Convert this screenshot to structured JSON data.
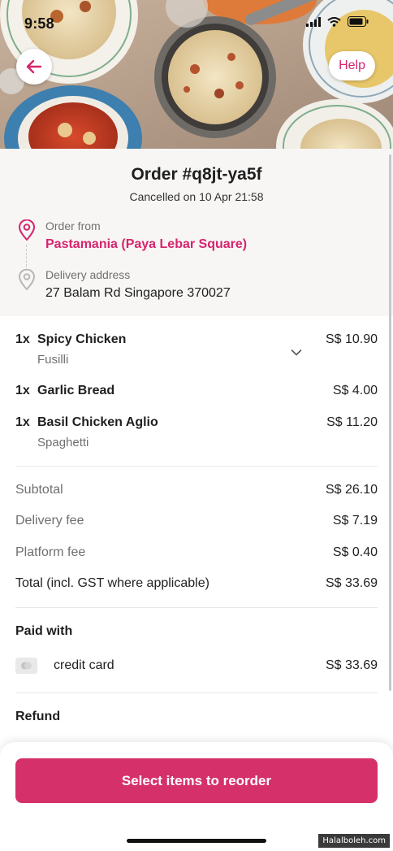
{
  "status_bar": {
    "time": "9:58"
  },
  "header": {
    "help_label": "Help",
    "back_icon": "arrow-left-icon"
  },
  "order": {
    "title": "Order #q8jt-ya5f",
    "status": "Cancelled on 10 Apr 21:58",
    "from_label": "Order from",
    "restaurant": "Pastamania (Paya Lebar Square)",
    "address_label": "Delivery address",
    "address": "27 Balam Rd Singapore 370027"
  },
  "items": [
    {
      "qty": "1x",
      "name": "Spicy Chicken",
      "option": "Fusilli",
      "price": "S$ 10.90"
    },
    {
      "qty": "1x",
      "name": "Garlic Bread",
      "option": "",
      "price": "S$ 4.00"
    },
    {
      "qty": "1x",
      "name": "Basil Chicken Aglio",
      "option": "Spaghetti",
      "price": "S$ 11.20"
    }
  ],
  "summary": {
    "subtotal_label": "Subtotal",
    "subtotal": "S$ 26.10",
    "delivery_label": "Delivery fee",
    "delivery": "S$ 7.19",
    "platform_label": "Platform fee",
    "platform": "S$ 0.40",
    "total_label": "Total (incl. GST where applicable)",
    "total": "S$ 33.69"
  },
  "payment": {
    "title": "Paid with",
    "method": "credit card",
    "amount": "S$ 33.69"
  },
  "refund": {
    "title": "Refund"
  },
  "actions": {
    "reorder_label": "Select items to reorder"
  },
  "watermark": "Halalboleh.com",
  "colors": {
    "accent": "#d6246e",
    "button": "#d6306a",
    "header_bg": "#f7f6f5"
  }
}
